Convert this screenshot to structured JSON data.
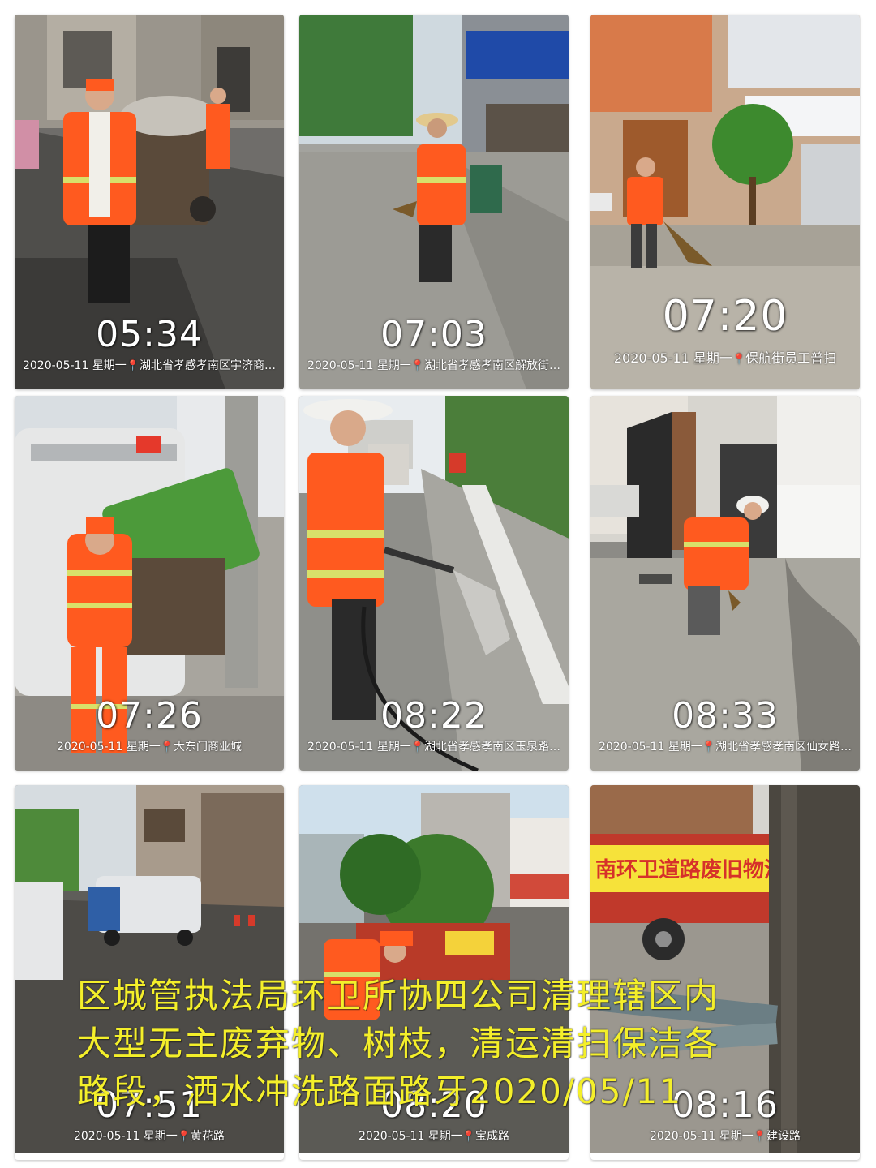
{
  "tiles": [
    {
      "time": "05:34",
      "date": "2020-05-11",
      "weekday": "星期一",
      "location": "湖北省孝感孝南区宇济商…"
    },
    {
      "time": "07:03",
      "date": "2020-05-11",
      "weekday": "星期一",
      "location": "湖北省孝感孝南区解放街…"
    },
    {
      "time": "07:20",
      "date": "2020-05-11",
      "weekday": "星期一",
      "location": "保航街员工普扫"
    },
    {
      "time": "07:26",
      "date": "2020-05-11",
      "weekday": "星期一",
      "location": "大东门商业城"
    },
    {
      "time": "08:22",
      "date": "2020-05-11",
      "weekday": "星期一",
      "location": "湖北省孝感孝南区玉泉路…"
    },
    {
      "time": "08:33",
      "date": "2020-05-11",
      "weekday": "星期一",
      "location": "湖北省孝感孝南区仙女路…"
    },
    {
      "time": "07:51",
      "date": "2020-05-11",
      "weekday": "星期一",
      "location": "黄花路"
    },
    {
      "time": "08:20",
      "date": "2020-05-11",
      "weekday": "星期一",
      "location": "宝成路"
    },
    {
      "time": "08:16",
      "date": "2020-05-11",
      "weekday": "星期一",
      "location": "建设路"
    }
  ],
  "signs": {
    "truck_banner": "南环卫道路废旧物清运专用"
  },
  "caption": [
    "区城管执法局环卫所协四公司清理辖区内",
    "大型无主废弃物、树枝，清运清扫保洁各",
    "路段，洒水冲洗路面路牙2020/05/11"
  ],
  "colors": {
    "vest_orange": "#ff5a1f",
    "reflective_stripe": "#d8e06a",
    "caption_yellow": "#f4ef2a",
    "pin_red": "#e53935"
  }
}
